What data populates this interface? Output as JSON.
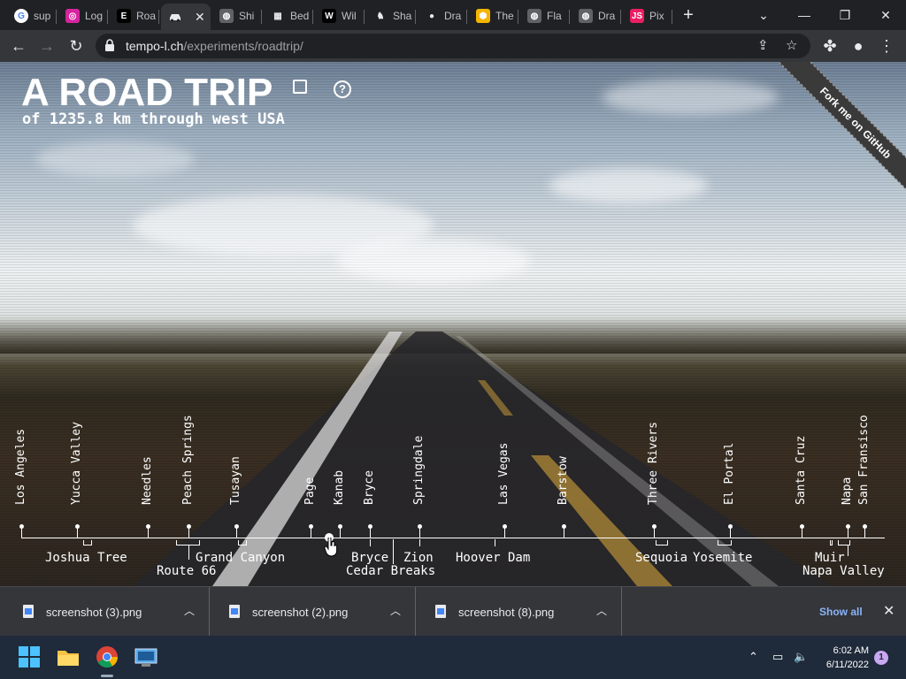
{
  "browser": {
    "tabs": [
      {
        "label": "sup",
        "icon": "google-icon",
        "color": "#ffffff",
        "text": "G"
      },
      {
        "label": "Log",
        "icon": "instagram-icon",
        "color": "#d6249f",
        "text": "◎"
      },
      {
        "label": "Roa",
        "icon": "e-icon",
        "color": "#000000",
        "text": "E"
      },
      {
        "label": "",
        "icon": "car-icon",
        "active": true
      },
      {
        "label": "Shi",
        "icon": "globe-icon",
        "color": "#5f6368",
        "text": "◍"
      },
      {
        "label": "Bed",
        "icon": "bed-icon",
        "color": "#ffffff",
        "text": "▦"
      },
      {
        "label": "Wil",
        "icon": "w-icon",
        "color": "#000000",
        "text": "W"
      },
      {
        "label": "Sha",
        "icon": "horse-icon",
        "color": "#ffffff",
        "text": "♞"
      },
      {
        "label": "Dra",
        "icon": "github-icon",
        "color": "#ffffff",
        "text": "●"
      },
      {
        "label": "The",
        "icon": "hex-icon",
        "color": "#f4b400",
        "text": "⬢"
      },
      {
        "label": "Fla",
        "icon": "globe-icon",
        "color": "#5f6368",
        "text": "◍"
      },
      {
        "label": "Dra",
        "icon": "globe-icon",
        "color": "#5f6368",
        "text": "◍"
      },
      {
        "label": "Pix",
        "icon": "js-icon",
        "color": "#e91e63",
        "text": "JS"
      }
    ],
    "url_host": "tempo-l.ch",
    "url_path": "/experiments/roadtrip/"
  },
  "page": {
    "title": "A ROAD TRIP",
    "subtitle": "of 1235.8 km through west USA",
    "ribbon": "Fork me on GitHub",
    "help": "?",
    "stops": [
      {
        "name": "Los Angeles"
      },
      {
        "name": "Yucca Valley"
      },
      {
        "name": "Needles"
      },
      {
        "name": "Peach Springs"
      },
      {
        "name": "Tusayan"
      },
      {
        "name": "Page"
      },
      {
        "name": "Kanab"
      },
      {
        "name": "Bryce"
      },
      {
        "name": "Springdale"
      },
      {
        "name": "Las Vegas"
      },
      {
        "name": "Barstow"
      },
      {
        "name": "Three Rivers"
      },
      {
        "name": "El Portal"
      },
      {
        "name": "Santa Cruz"
      },
      {
        "name": "Napa"
      },
      {
        "name": "San Fransisco"
      }
    ],
    "regions": [
      {
        "name": "Joshua Tree"
      },
      {
        "name": "Route 66"
      },
      {
        "name": "Grand Canyon"
      },
      {
        "name": "Bryce"
      },
      {
        "name": "Zion"
      },
      {
        "name": "Cedar Breaks"
      },
      {
        "name": "Hoover Dam"
      },
      {
        "name": "Sequoia"
      },
      {
        "name": "Yosemite"
      },
      {
        "name": "Muir"
      },
      {
        "name": "Napa Valley"
      }
    ]
  },
  "downloads": {
    "items": [
      "screenshot (3).png",
      "screenshot (2).png",
      "screenshot (8).png"
    ],
    "show_all": "Show all"
  },
  "taskbar": {
    "time": "6:02 AM",
    "date": "6/11/2022",
    "notifications": "1"
  }
}
